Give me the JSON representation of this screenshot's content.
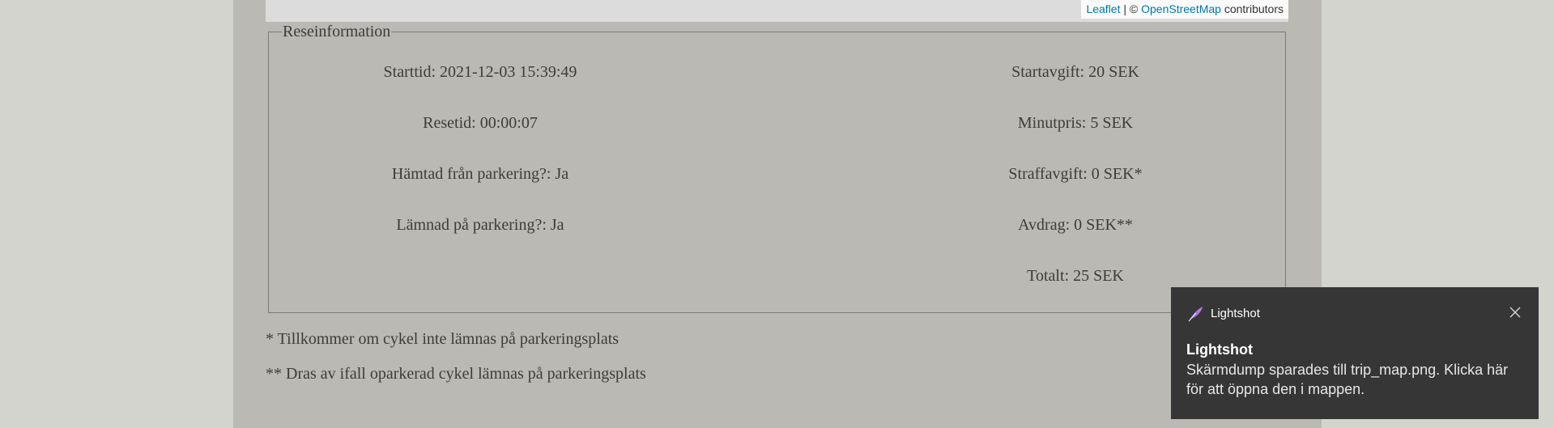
{
  "map": {
    "attribution_leaflet": "Leaflet",
    "attribution_separator": " | © ",
    "attribution_osm": "OpenStreetMap",
    "attribution_suffix": " contributors"
  },
  "trip_info": {
    "legend": "Reseinformation",
    "left": [
      "Starttid: 2021-12-03 15:39:49",
      "Resetid: 00:00:07",
      "Hämtad från parkering?: Ja",
      "Lämnad på parkering?: Ja"
    ],
    "right": [
      "Startavgift: 20 SEK",
      "Minutpris: 5 SEK",
      "Straffavgift: 0 SEK*",
      "Avdrag: 0 SEK**",
      "Totalt: 25 SEK"
    ]
  },
  "notes": [
    "* Tillkommer om cykel inte lämnas på parkeringsplats",
    "** Dras av ifall oparkerad cykel lämnas på parkeringsplats"
  ],
  "toast": {
    "app_name": "Lightshot",
    "app_icon": "lightshot-feather-icon",
    "title": "Lightshot",
    "body": "Skärmdump sparades till trip_map.png. Klicka här för att öppna den i mappen.",
    "close_icon": "close-icon",
    "accent_color": "#9b6bd8",
    "background_color": "#363636"
  },
  "colors": {
    "page_background": "#d3d4ce",
    "content_background": "#bab9b3",
    "text": "#3c3c3c",
    "link": "#0078a8"
  }
}
